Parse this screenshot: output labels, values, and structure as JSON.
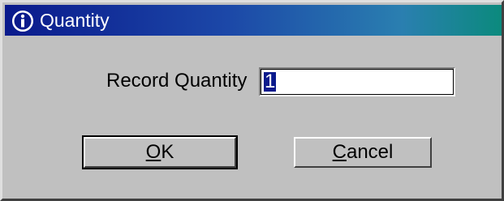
{
  "dialog": {
    "title": "Quantity",
    "title_icon": "info-icon",
    "field_label": "Record Quantity",
    "field_value": "1",
    "ok_label": "OK",
    "cancel_label": "Cancel"
  },
  "colors": {
    "titlebar_start": "#0a1a8c",
    "titlebar_end": "#0b8a7d",
    "dialog_bg": "#c0c0c0"
  }
}
